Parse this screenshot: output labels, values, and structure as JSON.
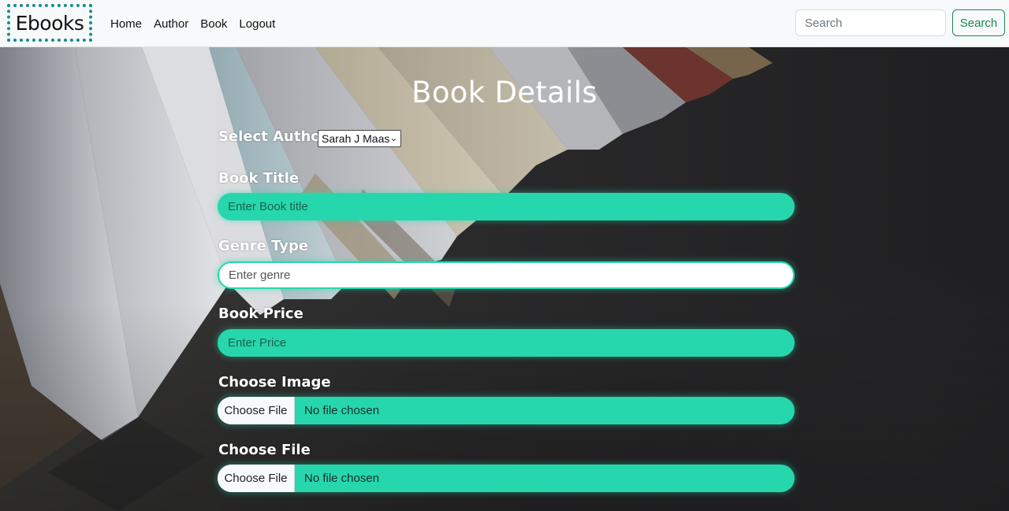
{
  "nav": {
    "brand": "Ebooks",
    "links": [
      "Home",
      "Author",
      "Book",
      "Logout"
    ],
    "search_placeholder": "Search",
    "search_button": "Search"
  },
  "form": {
    "title": "Book Details",
    "author_label": "Select Author",
    "author_selected": "Sarah J Maas",
    "title_label": "Book Title",
    "title_placeholder": "Enter Book title",
    "genre_label": "Genre Type",
    "genre_placeholder": "Enter genre",
    "price_label": "Book Price",
    "price_placeholder": "Enter Price",
    "image_label": "Choose Image",
    "image_button": "Choose File",
    "image_status": "No file chosen",
    "file_label": "Choose File",
    "file_button": "Choose File",
    "file_status": "No file chosen"
  },
  "colors": {
    "accent": "#26d7ad",
    "brand_border": "#138f8c",
    "search_button": "#198754"
  },
  "icons": {
    "select_caret": "chevron-down-icon"
  }
}
